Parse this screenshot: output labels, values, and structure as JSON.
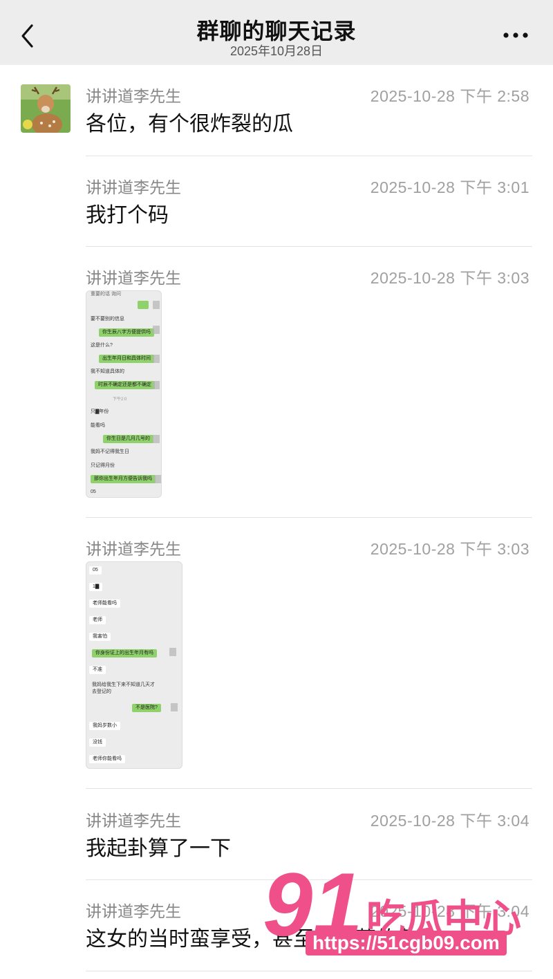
{
  "header": {
    "title": "群聊的聊天记录",
    "date": "2025年10月28日"
  },
  "messages": [
    {
      "sender": "讲讲道李先生",
      "time": "2025-10-28 下午 2:58",
      "text": "各位，有个很炸裂的瓜"
    },
    {
      "sender": "讲讲道李先生",
      "time": "2025-10-28 下午 3:01",
      "text": "我打个码"
    },
    {
      "sender": "讲讲道李先生",
      "time": "2025-10-28 下午 3:03"
    },
    {
      "sender": "讲讲道李先生",
      "time": "2025-10-28 下午 3:03"
    },
    {
      "sender": "讲讲道李先生",
      "time": "2025-10-28 下午 3:04",
      "text": "我起卦算了一下"
    },
    {
      "sender": "讲讲道李先生",
      "time": "2025-10-28 下午 3:04",
      "text": "这女的当时蛮享受，甚至有嗑药的象"
    }
  ],
  "shot1": {
    "lines": [
      "重要的话 询问",
      "要不要别的信息",
      "你生辰八字方便提供吗",
      "这是什么?",
      "出生年月日和具体时间",
      "我不知道具体的",
      "时辰不确定还是都不确定",
      "下午2:0",
      "只▇年份",
      "能看吗",
      "你生日是几月几号的",
      "我妈不记得我生日",
      "只记得月份",
      "那你出生年月方便告诉我吗",
      "05"
    ]
  },
  "shot2": {
    "lines": [
      "05",
      "1▇",
      "老师能看吗",
      "老师",
      "我害怕",
      "你身份证上的出生年月有吗",
      "不准",
      "我妈给我生下来不知道几天才",
      "去登记的",
      "不是医院?",
      "我妈岁数小",
      "没钱",
      "老师你能看吗"
    ]
  },
  "watermark": {
    "number": "91",
    "name": "吃瓜中心",
    "url": "https://51cgb09.com"
  }
}
